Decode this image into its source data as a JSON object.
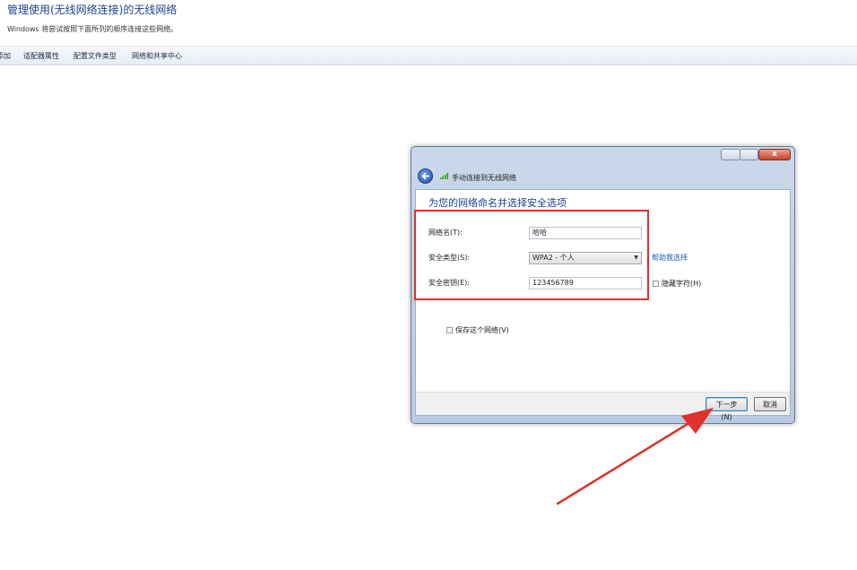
{
  "header": {
    "title": "管理使用(无线网络连接)的无线网络",
    "subtitle": "Windows 将尝试按照下面所列的顺序连接这些网络。"
  },
  "toolbar": {
    "items": [
      "添加",
      "适配器属性",
      "配置文件类型",
      "网络和共享中心"
    ]
  },
  "dialog": {
    "caption": "手动连接到无线网络",
    "close_glyph": "x",
    "heading": "为您的网络命名并选择安全选项",
    "network_name": {
      "label": "网络名(T):",
      "value": "哈哈"
    },
    "security_type": {
      "label": "安全类型(S):",
      "value": "WPA2 - 个人",
      "help_link": "帮助我选择"
    },
    "security_key": {
      "label": "安全密钥(E):",
      "value": "123456789",
      "hide_chars_label": "隐藏字符(H)"
    },
    "save_network_label": "保存这个网络(V)",
    "next_button": "下一步(N)",
    "cancel_button": "取消"
  },
  "colors": {
    "title_blue": "#1e3f8f",
    "annotation_red": "#e0312a",
    "link_blue": "#1f5bb5"
  },
  "icons": [
    "back-arrow-icon",
    "wireless-signal-icon",
    "close-icon",
    "minimize-icon",
    "maximize-icon",
    "dropdown-arrow-icon"
  ]
}
